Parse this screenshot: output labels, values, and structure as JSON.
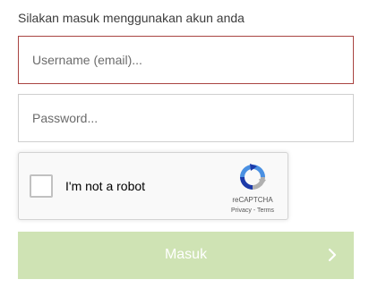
{
  "instruction": "Silakan masuk menggunakan akun anda",
  "username": {
    "placeholder": "Username (email)...",
    "value": ""
  },
  "password": {
    "placeholder": "Password...",
    "value": ""
  },
  "recaptcha": {
    "label": "I'm not a robot",
    "brand": "reCAPTCHA",
    "privacy": "Privacy",
    "separator": " - ",
    "terms": "Terms"
  },
  "submit": {
    "label": "Masuk",
    "icon": "chevron-right-icon"
  },
  "colors": {
    "error_border": "#a94442",
    "button_bg": "#cfe3b4",
    "button_text": "#ffffff"
  }
}
